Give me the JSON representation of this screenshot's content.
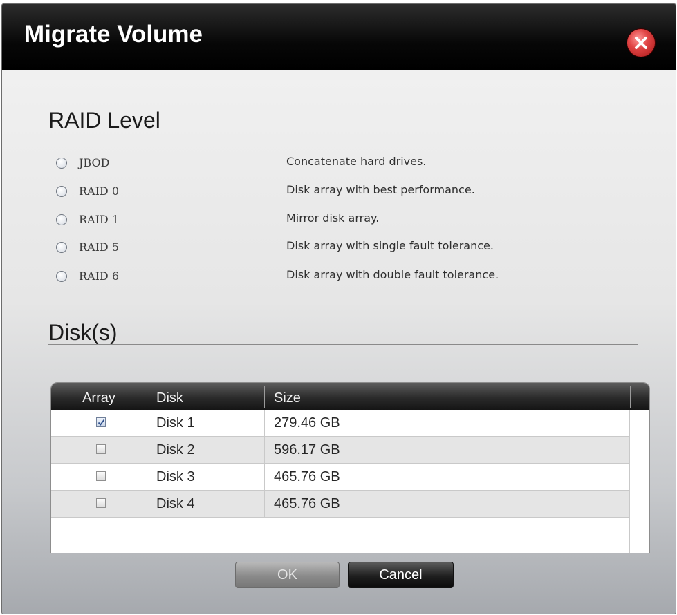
{
  "dialog": {
    "title": "Migrate Volume",
    "close_icon": "close-x-icon"
  },
  "raid_section": {
    "title": "RAID Level",
    "options": [
      {
        "label": "JBOD",
        "description": "Concatenate hard drives.",
        "selected": false
      },
      {
        "label": "RAID 0",
        "description": "Disk array with best performance.",
        "selected": false
      },
      {
        "label": "RAID 1",
        "description": "Mirror disk array.",
        "selected": false
      },
      {
        "label": "RAID 5",
        "description": "Disk array with single fault tolerance.",
        "selected": false
      },
      {
        "label": "RAID 6",
        "description": "Disk array with double fault tolerance.",
        "selected": false
      }
    ]
  },
  "disks_section": {
    "title": "Disk(s)",
    "columns": [
      "Array",
      "Disk",
      "Size"
    ],
    "rows": [
      {
        "checked": true,
        "disk": "Disk 1",
        "size": "279.46 GB"
      },
      {
        "checked": false,
        "disk": "Disk 2",
        "size": "596.17 GB"
      },
      {
        "checked": false,
        "disk": "Disk 3",
        "size": "465.76 GB"
      },
      {
        "checked": false,
        "disk": "Disk 4",
        "size": "465.76 GB"
      }
    ]
  },
  "buttons": {
    "ok_label": "OK",
    "cancel_label": "Cancel"
  },
  "colors": {
    "title_bar": "#000000",
    "close_button": "#d63a3a",
    "header_bar": "#2b2b2b"
  }
}
